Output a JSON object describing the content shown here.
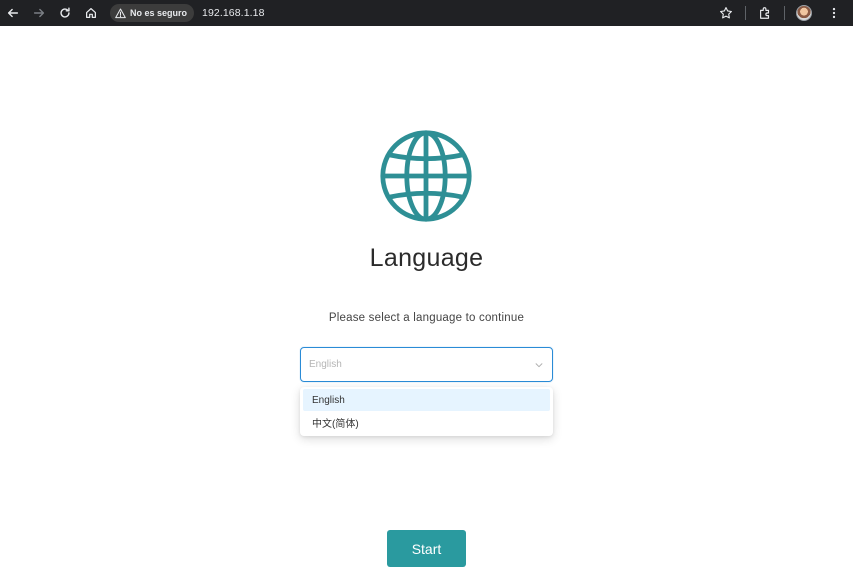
{
  "browser": {
    "security_label": "No es seguro",
    "url": "192.168.1.18",
    "icons": [
      "back-icon",
      "forward-icon",
      "reload-icon",
      "home-icon",
      "warning-icon",
      "star-icon",
      "extensions-icon",
      "profile-avatar",
      "more-menu-icon"
    ]
  },
  "page": {
    "title": "Language",
    "subtitle": "Please select a language to continue",
    "accent_color": "#2a9a9f",
    "globe_color": "#2e8f95"
  },
  "language_select": {
    "placeholder": "English",
    "options": [
      {
        "label": "English",
        "highlighted": true
      },
      {
        "label": "中文(简体)",
        "highlighted": false
      }
    ]
  },
  "start_button": {
    "label": "Start"
  }
}
